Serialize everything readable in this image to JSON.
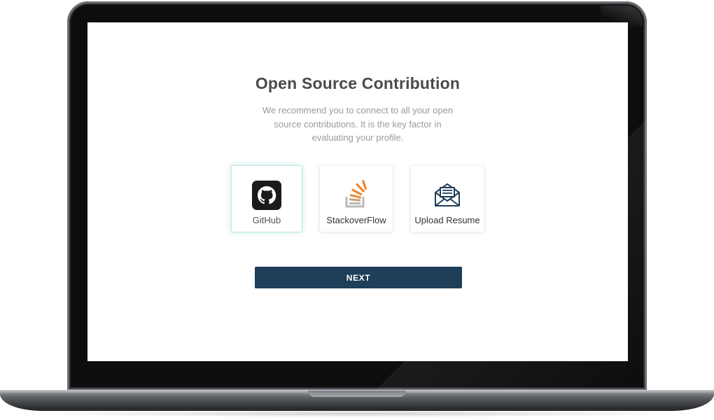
{
  "page": {
    "title": "Open Source Contribution",
    "subtitle": "We recommend you to connect to all your open source contributions. It is the key factor in evaluating your profile."
  },
  "options": [
    {
      "label": "GitHub",
      "icon": "github-icon",
      "selected": true
    },
    {
      "label": "StackoverFlow",
      "icon": "stackoverflow-icon",
      "selected": false
    },
    {
      "label": "Upload Resume",
      "icon": "envelope-icon",
      "selected": false
    }
  ],
  "actions": {
    "next_label": "NEXT"
  },
  "colors": {
    "primary_button": "#1f3e5a",
    "selected_glow": "#bfe6e2",
    "stackoverflow_orange": "#f48024",
    "stackoverflow_gray": "#bcbbbb",
    "envelope_navy": "#1f3e5a"
  }
}
